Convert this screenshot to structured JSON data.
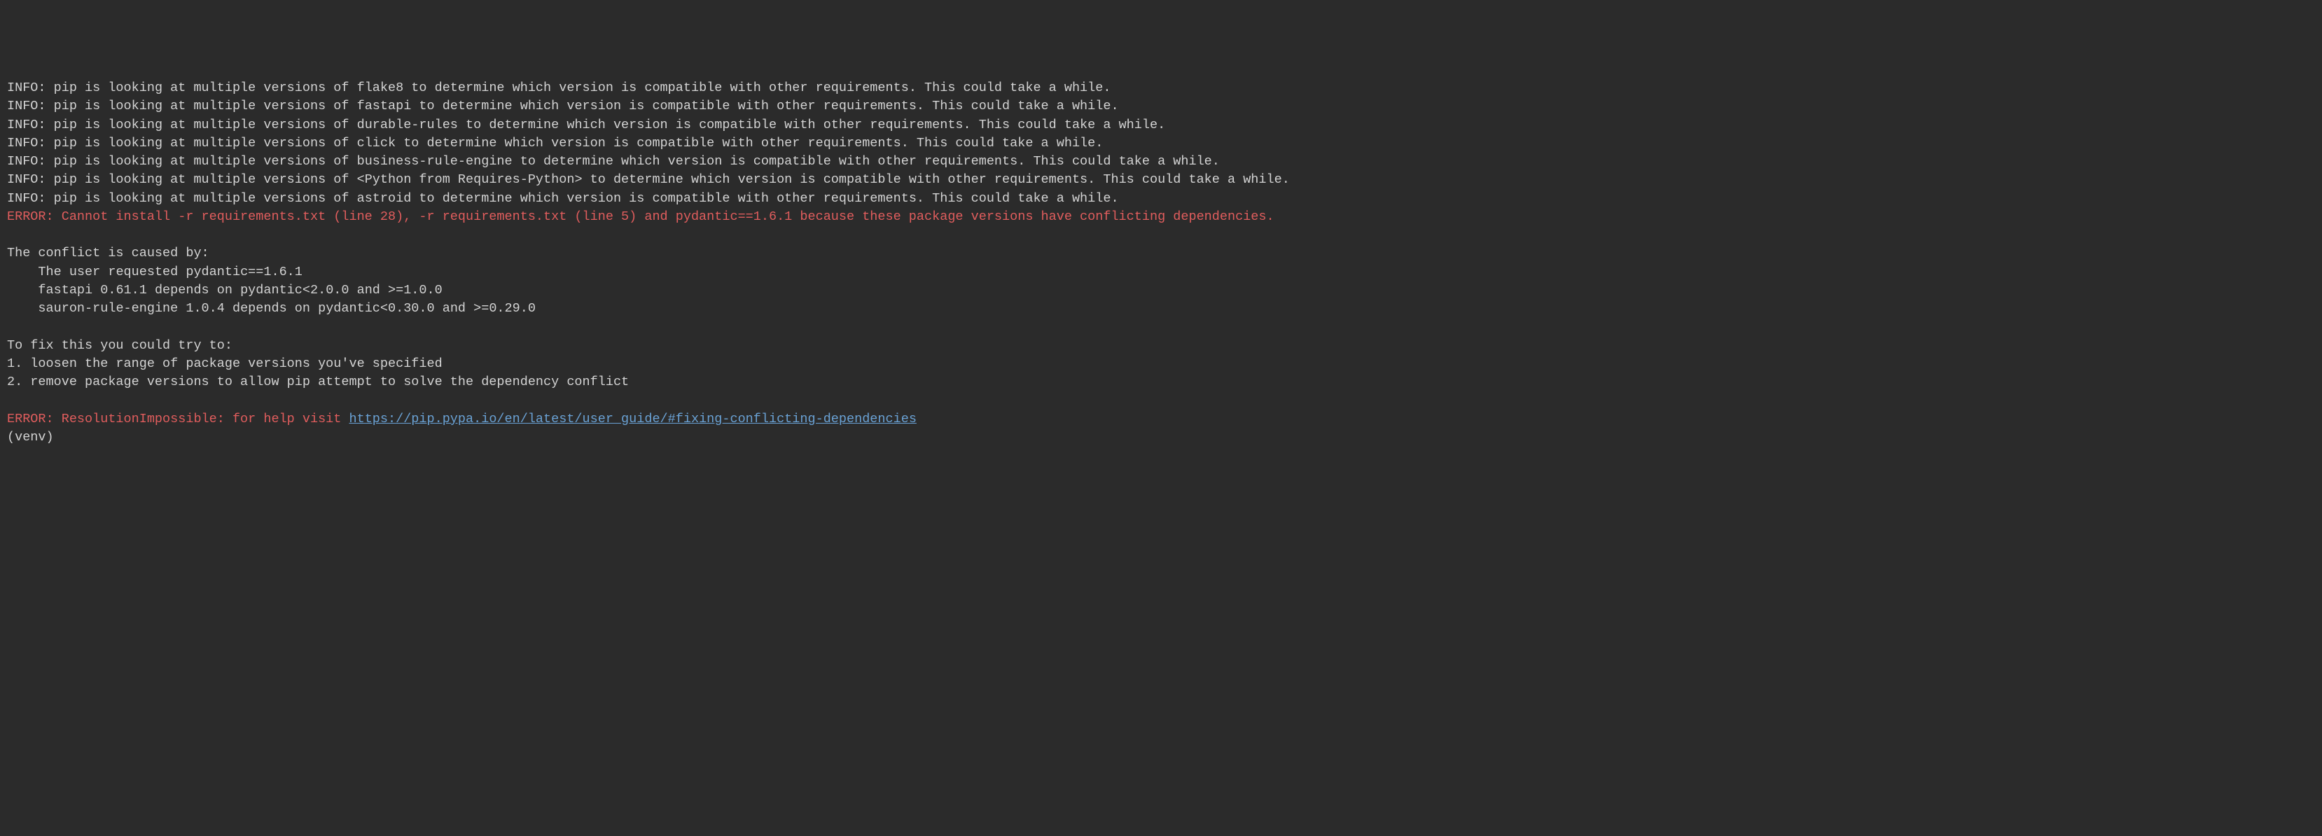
{
  "lines": [
    {
      "type": "info",
      "prefix": "INFO:",
      "text": " pip is looking at multiple versions of flake8 to determine which version is compatible with other requirements. This could take a while."
    },
    {
      "type": "info",
      "prefix": "INFO:",
      "text": " pip is looking at multiple versions of fastapi to determine which version is compatible with other requirements. This could take a while."
    },
    {
      "type": "info",
      "prefix": "INFO:",
      "text": " pip is looking at multiple versions of durable-rules to determine which version is compatible with other requirements. This could take a while."
    },
    {
      "type": "info",
      "prefix": "INFO:",
      "text": " pip is looking at multiple versions of click to determine which version is compatible with other requirements. This could take a while."
    },
    {
      "type": "info",
      "prefix": "INFO:",
      "text": " pip is looking at multiple versions of business-rule-engine to determine which version is compatible with other requirements. This could take a while."
    },
    {
      "type": "info",
      "prefix": "INFO:",
      "text": " pip is looking at multiple versions of <Python from Requires-Python> to determine which version is compatible with other requirements. This could take a while."
    },
    {
      "type": "info",
      "prefix": "INFO:",
      "text": " pip is looking at multiple versions of astroid to determine which version is compatible with other requirements. This could take a while."
    },
    {
      "type": "error",
      "text": "ERROR: Cannot install -r requirements.txt (line 28), -r requirements.txt (line 5) and pydantic==1.6.1 because these package versions have conflicting dependencies."
    },
    {
      "type": "blank",
      "text": ""
    },
    {
      "type": "plain",
      "text": "The conflict is caused by:"
    },
    {
      "type": "plain",
      "text": "    The user requested pydantic==1.6.1"
    },
    {
      "type": "plain",
      "text": "    fastapi 0.61.1 depends on pydantic<2.0.0 and >=1.0.0"
    },
    {
      "type": "plain",
      "text": "    sauron-rule-engine 1.0.4 depends on pydantic<0.30.0 and >=0.29.0"
    },
    {
      "type": "blank",
      "text": ""
    },
    {
      "type": "plain",
      "text": "To fix this you could try to:"
    },
    {
      "type": "plain",
      "text": "1. loosen the range of package versions you've specified"
    },
    {
      "type": "plain",
      "text": "2. remove package versions to allow pip attempt to solve the dependency conflict"
    },
    {
      "type": "blank",
      "text": ""
    },
    {
      "type": "error-with-link",
      "before": "ERROR: ResolutionImpossible: for help visit ",
      "link_text": "https://pip.pypa.io/en/latest/user_guide/#fixing-conflicting-dependencies",
      "link_href": "https://pip.pypa.io/en/latest/user_guide/#fixing-conflicting-dependencies"
    },
    {
      "type": "plain",
      "text": "(venv)"
    }
  ]
}
